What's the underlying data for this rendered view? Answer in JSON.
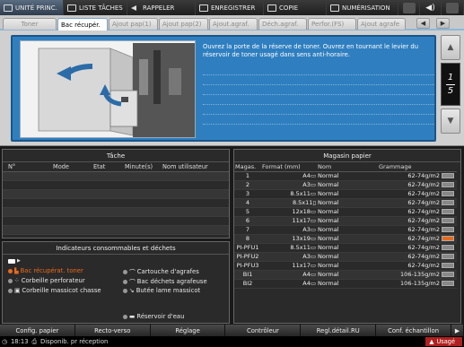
{
  "topbar": {
    "items": [
      {
        "label": "UNITÉ PRINC.",
        "icon": "printer-icon"
      },
      {
        "label": "LISTE TÂCHES",
        "icon": "list-icon"
      },
      {
        "label": "RAPPELER",
        "icon": "recall-icon"
      },
      {
        "label": "ENREGISTRER",
        "icon": "save-icon"
      },
      {
        "label": "COPIE",
        "icon": "copy-icon"
      },
      {
        "label": "NUMÉRISATION",
        "icon": "scan-icon"
      }
    ],
    "speaker_icon": "speaker-icon"
  },
  "tabs": [
    {
      "label": "Toner",
      "active": false
    },
    {
      "label": "Bac récupér.",
      "active": true
    },
    {
      "label": "Ajout pap(1)",
      "active": false
    },
    {
      "label": "Ajout pap(2)",
      "active": false
    },
    {
      "label": "Ajout.agraf.",
      "active": false
    },
    {
      "label": "Déch.agraf.",
      "active": false
    },
    {
      "label": "Perfor.(FS)",
      "active": false
    },
    {
      "label": "Ajout agrafe",
      "active": false
    }
  ],
  "guide": {
    "text": "Ouvrez la porte de la réserve de toner. Ouvrez en tournant le levier du réservoir de toner usagé dans sens anti-horaire.",
    "page_current": "1",
    "page_total": "5"
  },
  "tache": {
    "title": "Tâche",
    "headers": [
      "N°",
      "Mode",
      "Etat",
      "Minute(s)",
      "Nom utilisateur"
    ]
  },
  "indic": {
    "title": "Indicateurs consommables et déchets",
    "items": {
      "bac": "Bac récupérat. toner",
      "corb_perf": "Corbeille perforateur",
      "corb_mass": "Corbeille massicot chasse",
      "cart": "Cartouche d'agrafes",
      "bac_dech": "Bac déchets agrafeuse",
      "butee": "Butée lame massicot",
      "reservoir": "Réservoir d'eau"
    }
  },
  "magasin": {
    "title": "Magasin papier",
    "headers": [
      "Magas.",
      "Format (mm)",
      "Nom",
      "Grammage"
    ],
    "rows": [
      {
        "mag": "1",
        "format": "A4▭",
        "nom": "Normal",
        "gram": "62-74g/m2",
        "low": false
      },
      {
        "mag": "2",
        "format": "A3▭",
        "nom": "Normal",
        "gram": "62-74g/m2",
        "low": false
      },
      {
        "mag": "3",
        "format": "8.5x11▭",
        "nom": "Normal",
        "gram": "62-74g/m2",
        "low": false
      },
      {
        "mag": "4",
        "format": "8.5x11▯",
        "nom": "Normal",
        "gram": "62-74g/m2",
        "low": false
      },
      {
        "mag": "5",
        "format": "12x18▭",
        "nom": "Normal",
        "gram": "62-74g/m2",
        "low": false
      },
      {
        "mag": "6",
        "format": "11x17▭",
        "nom": "Normal",
        "gram": "62-74g/m2",
        "low": false
      },
      {
        "mag": "7",
        "format": "A3▭",
        "nom": "Normal",
        "gram": "62-74g/m2",
        "low": false
      },
      {
        "mag": "8",
        "format": "13x19▭",
        "nom": "Normal",
        "gram": "62-74g/m2",
        "low": true
      },
      {
        "mag": "PI-PFU1",
        "format": "8.5x11▭",
        "nom": "Normal",
        "gram": "62-74g/m2",
        "low": false
      },
      {
        "mag": "PI-PFU2",
        "format": "A3▭",
        "nom": "Normal",
        "gram": "62-74g/m2",
        "low": false
      },
      {
        "mag": "PI-PFU3",
        "format": "11x17▭",
        "nom": "Normal",
        "gram": "62-74g/m2",
        "low": false
      },
      {
        "mag": "BI1",
        "format": "A4▭",
        "nom": "Normal",
        "gram": "106-135g/m2",
        "low": false
      },
      {
        "mag": "BI2",
        "format": "A4▭",
        "nom": "Normal",
        "gram": "106-135g/m2",
        "low": false
      }
    ]
  },
  "bottom": [
    "Config. papier",
    "Recto-verso",
    "Réglage",
    "Contrôleur",
    "Regl.détail.RU",
    "Conf. échantillon"
  ],
  "status": {
    "time": "18:13",
    "message": "Disponib. pr réception",
    "usage": "Usagé"
  }
}
